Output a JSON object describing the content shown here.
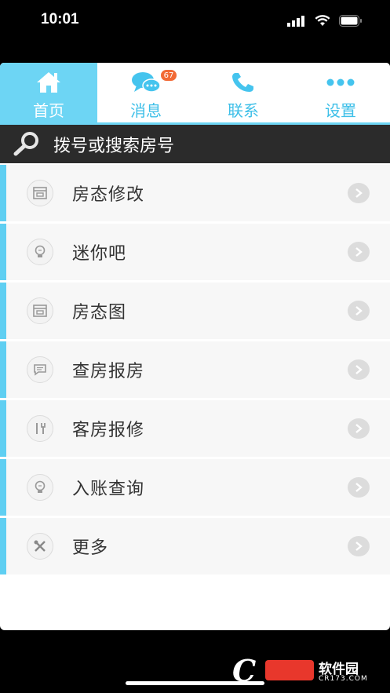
{
  "status_bar": {
    "time": "10:01"
  },
  "tabs": [
    {
      "label": "首页",
      "icon": "home-icon",
      "active": true
    },
    {
      "label": "消息",
      "icon": "chat-bubbles-icon",
      "badge": "67"
    },
    {
      "label": "联系",
      "icon": "phone-icon"
    },
    {
      "label": "设置",
      "icon": "more-dots-icon"
    }
  ],
  "search": {
    "placeholder": "拨号或搜索房号"
  },
  "menu": [
    {
      "label": "房态修改",
      "icon": "room-status-icon"
    },
    {
      "label": "迷你吧",
      "icon": "bulb-icon"
    },
    {
      "label": "房态图",
      "icon": "room-status-icon"
    },
    {
      "label": "查房报房",
      "icon": "message-icon"
    },
    {
      "label": "客房报修",
      "icon": "tools-icon"
    },
    {
      "label": "入账查询",
      "icon": "bulb-icon"
    },
    {
      "label": "更多",
      "icon": "wrench-icon"
    }
  ],
  "watermark": {
    "name": "软件园",
    "url": "CR173.COM"
  },
  "colors": {
    "accent": "#6dd5f4",
    "badge": "#f26a36",
    "search_bg": "#2b2b2b"
  }
}
